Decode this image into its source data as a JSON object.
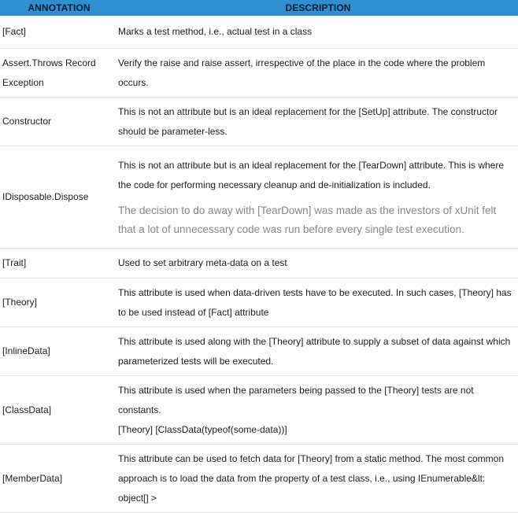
{
  "header": {
    "annotation": "ANNOTATION",
    "description": "DESCRIPTION"
  },
  "rows": [
    {
      "annotation": "[Fact]",
      "description": [
        "Marks a test method, i.e., actual test in a class"
      ]
    },
    {
      "annotation": "Assert.Throws Record Exception",
      "description": [
        "Verify the raise and raise assert, irrespective of the place in the code where the problem occurs."
      ]
    },
    {
      "annotation": "Constructor",
      "description": [
        "This is not an attribute but is an ideal replacement for the [SetUp] attribute. The constructor should be parameter-less."
      ]
    },
    {
      "annotation": "IDisposable.Dispose",
      "description": [
        "This is not an attribute but is an ideal replacement for the [TearDown] attribute. This is where the code for performing necessary cleanup and de-initialization is included."
      ],
      "note": "The decision to do away with [TearDown] was made as the investors of xUnit felt that a lot of unnecessary code was run before every single test execution."
    },
    {
      "annotation": "[Trait]",
      "description": [
        "Used to set arbitrary meta-data on a test"
      ]
    },
    {
      "annotation": "[Theory]",
      "description": [
        "This attribute is used when data-driven tests have to be executed. In such cases, [Theory] has to be used instead of [Fact] attribute"
      ]
    },
    {
      "annotation": "[InlineData]",
      "description": [
        "This attribute is used along with the [Theory] attribute to supply a subset of data against which parameterized tests will be executed."
      ]
    },
    {
      "annotation": "[ClassData]",
      "description": [
        "This attribute is used when the parameters being passed to the [Theory] tests are not constants.",
        "[Theory] [ClassData(typeof(some-data))]"
      ]
    },
    {
      "annotation": "[MemberData]",
      "description": [
        "This attribute can be used to fetch data for [Theory] from a static method. The most common approach is to load the data from the property of a test class, i.e., using IEnumerable&lt: object[] >"
      ]
    }
  ]
}
